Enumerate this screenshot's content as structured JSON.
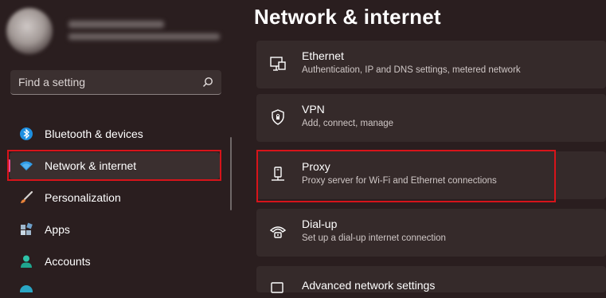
{
  "search": {
    "placeholder": "Find a setting"
  },
  "sidebar": {
    "items": [
      {
        "label": "Bluetooth & devices",
        "icon": "bluetooth-icon"
      },
      {
        "label": "Network & internet",
        "icon": "wifi-icon"
      },
      {
        "label": "Personalization",
        "icon": "brush-icon"
      },
      {
        "label": "Apps",
        "icon": "apps-icon"
      },
      {
        "label": "Accounts",
        "icon": "person-icon"
      }
    ]
  },
  "main": {
    "title": "Network & internet",
    "cards": [
      {
        "title": "Ethernet",
        "subtitle": "Authentication, IP and DNS settings, metered network",
        "icon": "ethernet-icon"
      },
      {
        "title": "VPN",
        "subtitle": "Add, connect, manage",
        "icon": "shield-icon"
      },
      {
        "title": "Proxy",
        "subtitle": "Proxy server for Wi-Fi and Ethernet connections",
        "icon": "proxy-icon"
      },
      {
        "title": "Dial-up",
        "subtitle": "Set up a dial-up internet connection",
        "icon": "dialup-icon"
      },
      {
        "title": "Advanced network settings",
        "subtitle": "",
        "icon": "monitor-icon"
      }
    ]
  },
  "colors": {
    "background": "#2a1e1f",
    "card": "#352a2a",
    "accent": "#ea4d9a",
    "highlight": "#d7141a"
  }
}
